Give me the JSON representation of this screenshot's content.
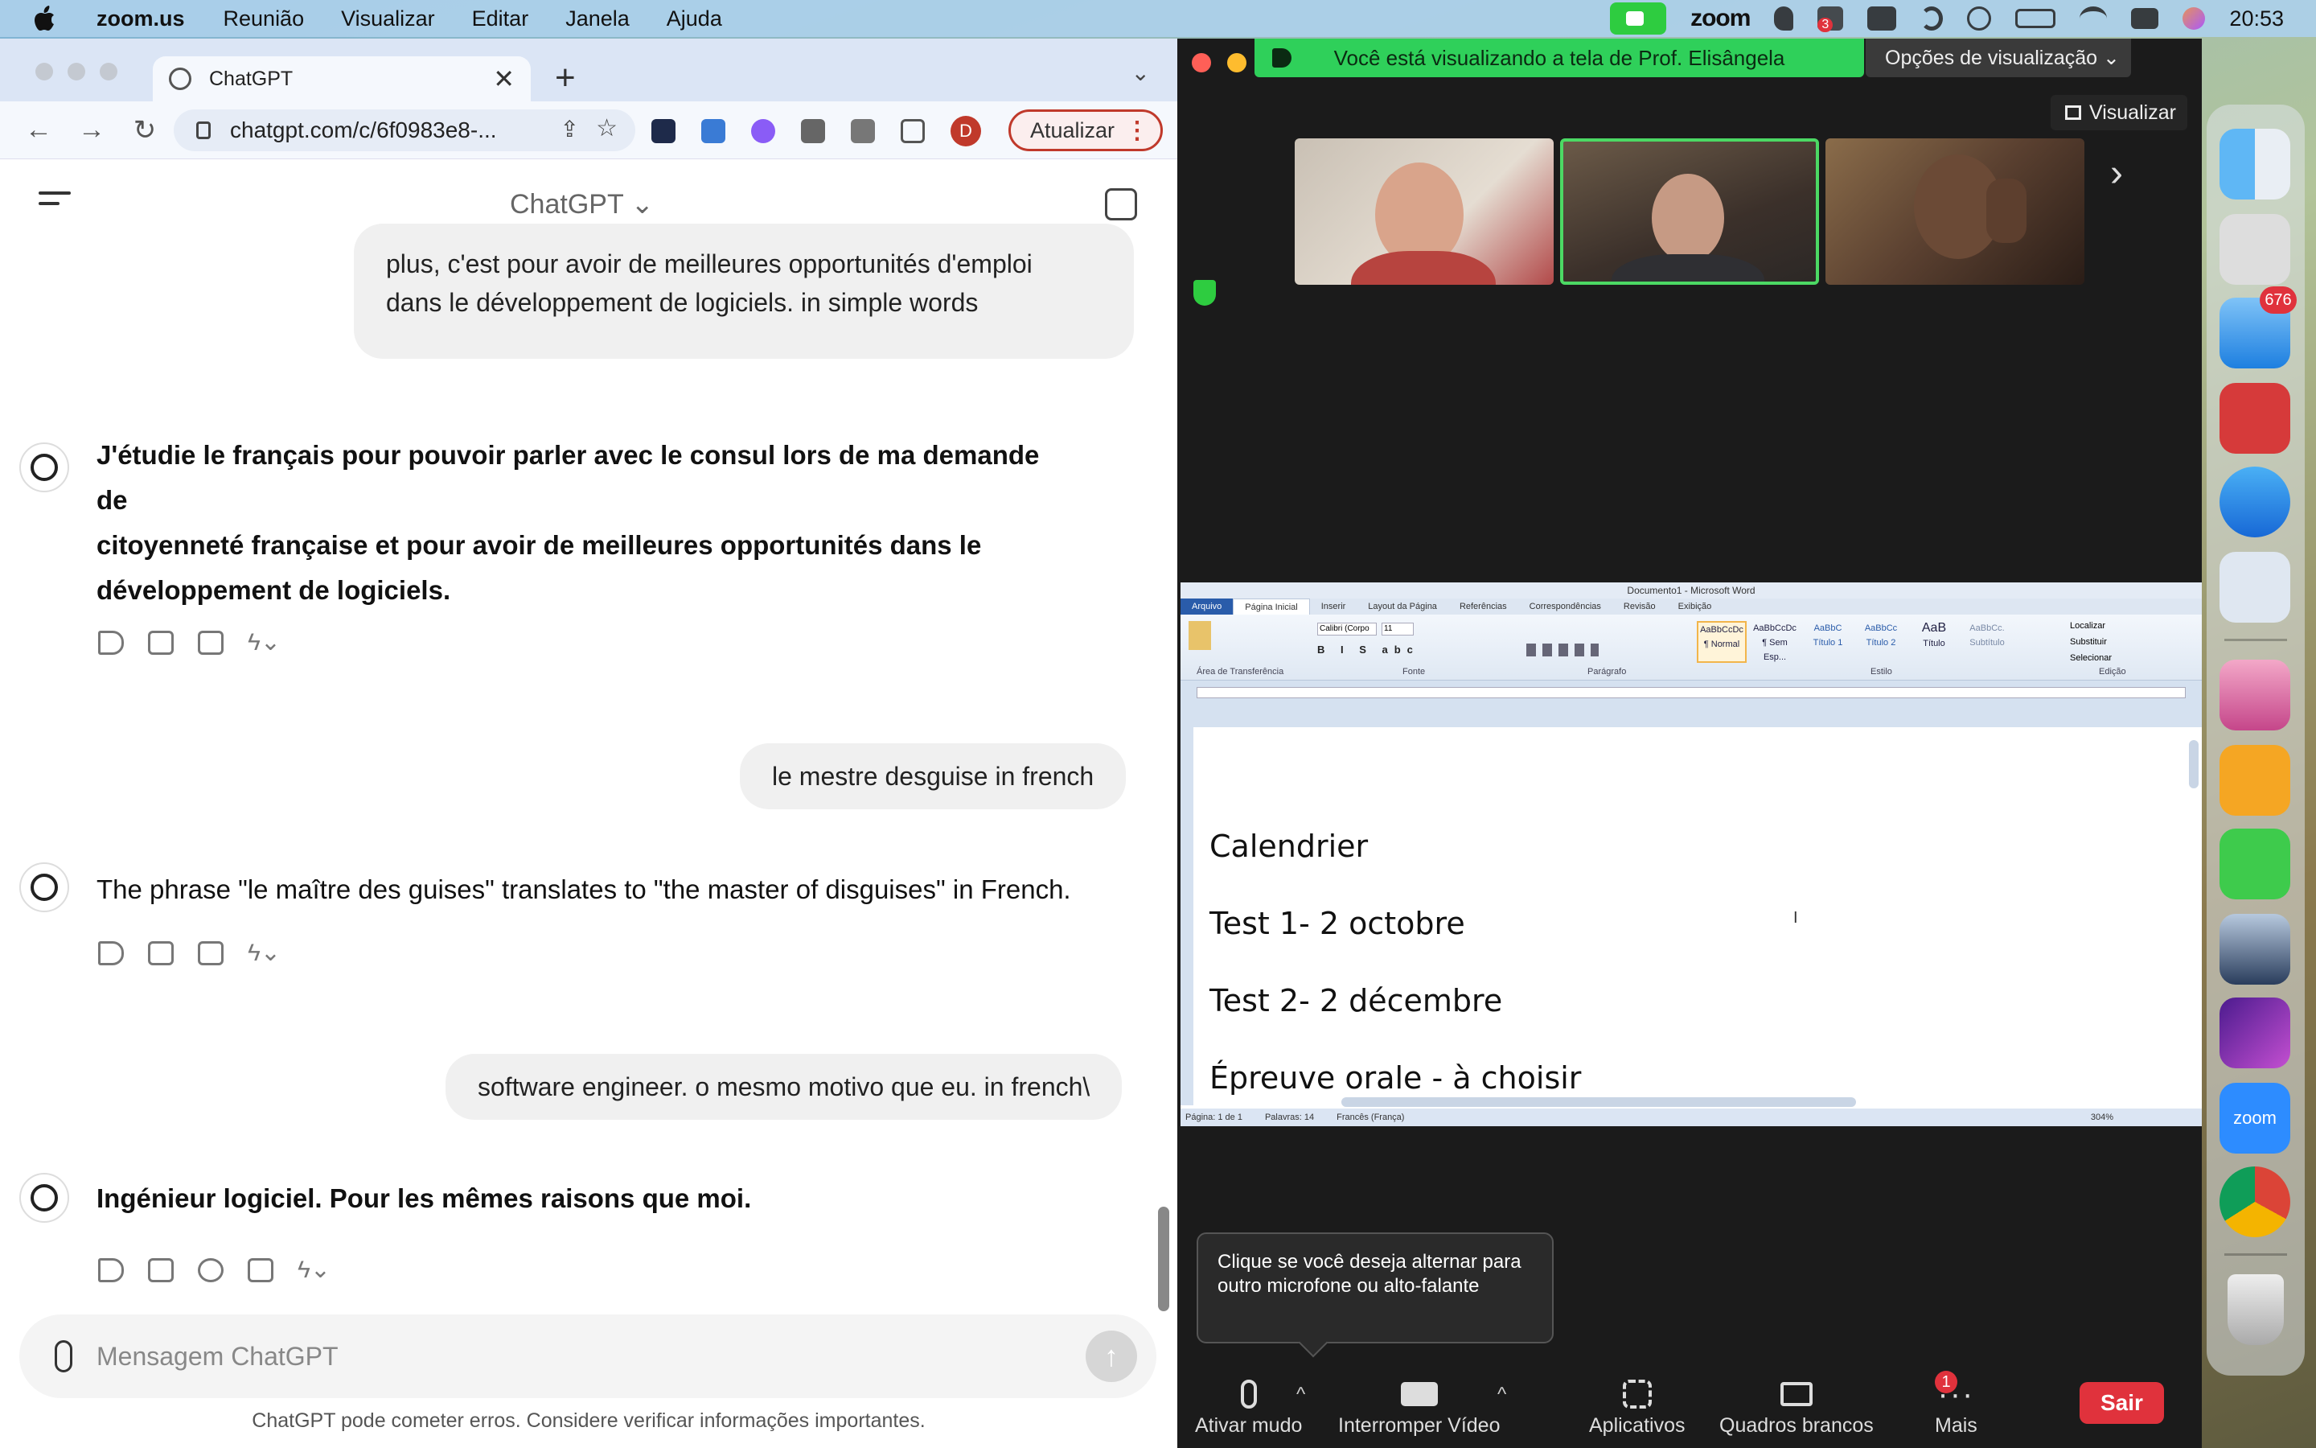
{
  "menubar": {
    "app_name": "zoom.us",
    "items": [
      "Reunião",
      "Visualizar",
      "Editar",
      "Janela",
      "Ajuda"
    ],
    "zoom_label": "zoom",
    "notification_badge": "3",
    "time": "20:53"
  },
  "browser": {
    "tab_title": "ChatGPT",
    "url": "chatgpt.com/c/6f0983e8-...",
    "profile_initial": "D",
    "update_label": "Atualizar"
  },
  "chatgpt": {
    "title": "ChatGPT",
    "messages": [
      {
        "role": "user",
        "text_lines": [
          "plus, c'est pour avoir de meilleures opportunités d'emploi",
          "dans le développement de logiciels. in simple words"
        ]
      },
      {
        "role": "assistant",
        "text_lines": [
          "J'étudie le français pour pouvoir parler avec le consul lors de ma demande de",
          "citoyenneté française et pour avoir de meilleures opportunités dans le",
          "développement de logiciels."
        ]
      },
      {
        "role": "user",
        "text": "le mestre desguise in french"
      },
      {
        "role": "assistant",
        "text": "The phrase \"le maître des guises\" translates to \"the master of disguises\" in French."
      },
      {
        "role": "user",
        "text": "software engineer. o mesmo motivo que eu. in french\\"
      },
      {
        "role": "assistant",
        "text": "Ingénieur logiciel. Pour les mêmes raisons que moi."
      }
    ],
    "composer_placeholder": "Mensagem ChatGPT",
    "disclaimer": "ChatGPT pode cometer erros. Considere verificar informações importantes."
  },
  "zoom": {
    "share_banner": "Você está visualizando a tela de Prof. Elisângela",
    "view_options": "Opções de visualização",
    "view_button": "Visualizar",
    "tooltip": "Clique se você deseja alternar para outro microfone ou alto-falante",
    "controls": {
      "mute": "Ativar mudo",
      "video": "Interromper Vídeo",
      "apps": "Aplicativos",
      "whiteboards": "Quadros brancos",
      "more": "Mais",
      "more_badge": "1",
      "leave": "Sair"
    }
  },
  "word": {
    "window_title": "Documento1 - Microsoft Word",
    "tabs": [
      "Arquivo",
      "Página Inicial",
      "Inserir",
      "Layout da Página",
      "Referências",
      "Correspondências",
      "Revisão",
      "Exibição"
    ],
    "groups": [
      "Área de Transferência",
      "Fonte",
      "Parágrafo",
      "Estilo",
      "Edição"
    ],
    "font_name": "Calibri (Corpo",
    "font_size": "11",
    "styles": [
      "¶ Normal",
      "¶ Sem Esp...",
      "Título 1",
      "Título 2",
      "Título",
      "Subtítulo"
    ],
    "edit_items": [
      "Localizar",
      "Substituir",
      "Selecionar"
    ],
    "doc_lines": [
      "Calendrier",
      "Test 1- 2 octobre",
      "Test 2- 2 décembre",
      "Épreuve orale -  à choisir"
    ],
    "status": {
      "page": "Página: 1 de 1",
      "words": "Palavras: 14",
      "language": "Francês (França)",
      "zoom": "304%"
    }
  },
  "dock": {
    "mail_badge": "676",
    "zoom_label": "zoom"
  }
}
